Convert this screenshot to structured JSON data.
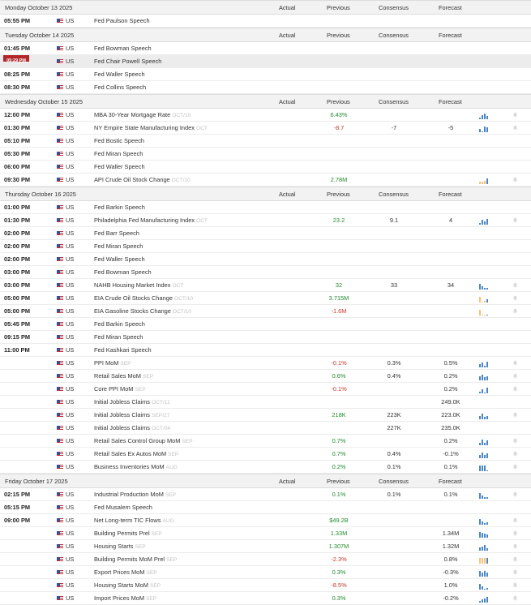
{
  "columns": {
    "actual": "Actual",
    "previous": "Previous",
    "consensus": "Consensus",
    "forecast": "Forecast"
  },
  "colors": {
    "positive": "#1f8b2c",
    "negative": "#c0392b",
    "bar": "#4a86c5",
    "bar_light": "#f5c27a",
    "live_badge": "#b2272a"
  },
  "days": [
    {
      "date": "Monday October 13 2025",
      "events": [
        {
          "time": "05:55 PM",
          "country": "US",
          "name": "Fed Paulson Speech",
          "period": "",
          "actual": "",
          "previous": "",
          "previous_tone": "",
          "consensus": "",
          "forecast": "",
          "chart": false,
          "bell": false
        }
      ]
    },
    {
      "date": "Tuesday October 14 2025",
      "events": [
        {
          "time": "01:45 PM",
          "country": "US",
          "name": "Fed Bowman Speech",
          "period": "",
          "actual": "",
          "previous": "",
          "previous_tone": "",
          "consensus": "",
          "forecast": "",
          "chart": false,
          "bell": false
        },
        {
          "time": "05:29 PM",
          "live": true,
          "country": "US",
          "name": "Fed Chair Powell Speech",
          "period": "",
          "actual": "",
          "previous": "",
          "previous_tone": "",
          "consensus": "",
          "forecast": "",
          "chart": false,
          "bell": false
        },
        {
          "time": "08:25 PM",
          "country": "US",
          "name": "Fed Waller Speech",
          "period": "",
          "actual": "",
          "previous": "",
          "previous_tone": "",
          "consensus": "",
          "forecast": "",
          "chart": false,
          "bell": false
        },
        {
          "time": "08:30 PM",
          "country": "US",
          "name": "Fed Collins Speech",
          "period": "",
          "actual": "",
          "previous": "",
          "previous_tone": "",
          "consensus": "",
          "forecast": "",
          "chart": false,
          "bell": false
        }
      ]
    },
    {
      "date": "Wednesday October 15 2025",
      "events": [
        {
          "time": "12:00 PM",
          "country": "US",
          "name": "MBA 30-Year Mortgage Rate",
          "period": "OCT/10",
          "actual": "",
          "previous": "6.43%",
          "previous_tone": "pos",
          "consensus": "",
          "forecast": "",
          "chart": true,
          "chart_bars": [
            2,
            4,
            6,
            3
          ],
          "bell": true
        },
        {
          "time": "01:30 PM",
          "country": "US",
          "name": "NY Empire State Manufacturing Index",
          "period": "OCT",
          "actual": "",
          "previous": "-8.7",
          "previous_tone": "neg",
          "consensus": "-7",
          "forecast": "-5",
          "chart": true,
          "chart_bars": [
            3,
            1,
            5,
            4
          ],
          "bell": true
        },
        {
          "time": "05:10 PM",
          "country": "US",
          "name": "Fed Bostic Speech",
          "period": "",
          "actual": "",
          "previous": "",
          "previous_tone": "",
          "consensus": "",
          "forecast": "",
          "chart": false,
          "bell": false
        },
        {
          "time": "05:30 PM",
          "country": "US",
          "name": "Fed Miran Speech",
          "period": "",
          "actual": "",
          "previous": "",
          "previous_tone": "",
          "consensus": "",
          "forecast": "",
          "chart": false,
          "bell": false
        },
        {
          "time": "06:00 PM",
          "country": "US",
          "name": "Fed Waller Speech",
          "period": "",
          "actual": "",
          "previous": "",
          "previous_tone": "",
          "consensus": "",
          "forecast": "",
          "chart": false,
          "bell": false
        },
        {
          "time": "09:30 PM",
          "country": "US",
          "name": "API Crude Oil Stock Change",
          "period": "OCT/10",
          "actual": "",
          "previous": "2.78M",
          "previous_tone": "pos",
          "consensus": "",
          "forecast": "",
          "chart": true,
          "chart_bars": [
            2,
            2,
            3,
            5
          ],
          "chart_light": true,
          "bell": true
        }
      ]
    },
    {
      "date": "Thursday October 16 2025",
      "events": [
        {
          "time": "01:00 PM",
          "country": "US",
          "name": "Fed Barkin Speech",
          "period": "",
          "actual": "",
          "previous": "",
          "previous_tone": "",
          "consensus": "",
          "forecast": "",
          "chart": false,
          "bell": false
        },
        {
          "time": "01:30 PM",
          "country": "US",
          "name": "Philadelphia Fed Manufacturing Index",
          "period": "OCT",
          "actual": "",
          "previous": "23.2",
          "previous_tone": "pos",
          "consensus": "9.1",
          "forecast": "4",
          "chart": true,
          "chart_bars": [
            2,
            5,
            3,
            6
          ],
          "bell": true
        },
        {
          "time": "02:00 PM",
          "country": "US",
          "name": "Fed Barr Speech",
          "period": "",
          "actual": "",
          "previous": "",
          "previous_tone": "",
          "consensus": "",
          "forecast": "",
          "chart": false,
          "bell": false
        },
        {
          "time": "02:00 PM",
          "country": "US",
          "name": "Fed Miran Speech",
          "period": "",
          "actual": "",
          "previous": "",
          "previous_tone": "",
          "consensus": "",
          "forecast": "",
          "chart": false,
          "bell": false
        },
        {
          "time": "02:00 PM",
          "country": "US",
          "name": "Fed Waller Speech",
          "period": "",
          "actual": "",
          "previous": "",
          "previous_tone": "",
          "consensus": "",
          "forecast": "",
          "chart": false,
          "bell": false
        },
        {
          "time": "03:00 PM",
          "country": "US",
          "name": "Fed Bowman Speech",
          "period": "",
          "actual": "",
          "previous": "",
          "previous_tone": "",
          "consensus": "",
          "forecast": "",
          "chart": false,
          "bell": false
        },
        {
          "time": "03:00 PM",
          "country": "US",
          "name": "NAHB Housing Market Index",
          "period": "OCT",
          "actual": "",
          "previous": "32",
          "previous_tone": "pos",
          "consensus": "33",
          "forecast": "34",
          "chart": true,
          "chart_bars": [
            6,
            3,
            2,
            2
          ],
          "bell": true
        },
        {
          "time": "05:00 PM",
          "country": "US",
          "name": "EIA Crude Oil Stocks Change",
          "period": "OCT/10",
          "actual": "",
          "previous": "3.715M",
          "previous_tone": "pos",
          "consensus": "",
          "forecast": "",
          "chart": true,
          "chart_bars": [
            6,
            1,
            2,
            3
          ],
          "chart_light": true,
          "bell": true
        },
        {
          "time": "05:00 PM",
          "country": "US",
          "name": "EIA Gasoline Stocks Change",
          "period": "OCT/10",
          "actual": "",
          "previous": "-1.6M",
          "previous_tone": "neg",
          "consensus": "",
          "forecast": "",
          "chart": true,
          "chart_bars": [
            7,
            1,
            1,
            1
          ],
          "chart_light": true,
          "bell": true
        },
        {
          "time": "05:45 PM",
          "country": "US",
          "name": "Fed Barkin Speech",
          "period": "",
          "actual": "",
          "previous": "",
          "previous_tone": "",
          "consensus": "",
          "forecast": "",
          "chart": false,
          "bell": false
        },
        {
          "time": "09:15 PM",
          "country": "US",
          "name": "Fed Miran Speech",
          "period": "",
          "actual": "",
          "previous": "",
          "previous_tone": "",
          "consensus": "",
          "forecast": "",
          "chart": false,
          "bell": false
        },
        {
          "time": "11:00 PM",
          "country": "US",
          "name": "Fed Kashkari Speech",
          "period": "",
          "actual": "",
          "previous": "",
          "previous_tone": "",
          "consensus": "",
          "forecast": "",
          "chart": false,
          "bell": false
        },
        {
          "time": "",
          "country": "US",
          "name": "PPI MoM",
          "period": "SEP",
          "actual": "",
          "previous": "-0.1%",
          "previous_tone": "neg",
          "consensus": "0.3%",
          "forecast": "0.5%",
          "chart": true,
          "chart_bars": [
            3,
            5,
            2,
            6
          ],
          "bell": true
        },
        {
          "time": "",
          "country": "US",
          "name": "Retail Sales MoM",
          "period": "SEP",
          "actual": "",
          "previous": "0.6%",
          "previous_tone": "pos",
          "consensus": "0.4%",
          "forecast": "0.2%",
          "chart": true,
          "chart_bars": [
            3,
            4,
            2,
            3
          ],
          "bell": true
        },
        {
          "time": "",
          "country": "US",
          "name": "Core PPI MoM",
          "period": "SEP",
          "actual": "",
          "previous": "-0.1%",
          "previous_tone": "neg",
          "consensus": "",
          "forecast": "0.2%",
          "chart": true,
          "chart_bars": [
            2,
            4,
            1,
            6
          ],
          "bell": true
        },
        {
          "time": "",
          "country": "US",
          "name": "Initial Jobless Claims",
          "period": "OCT/11",
          "actual": "",
          "previous": "",
          "previous_tone": "",
          "consensus": "",
          "forecast": "249.0K",
          "chart": false,
          "bell": false
        },
        {
          "time": "",
          "country": "US",
          "name": "Initial Jobless Claims",
          "period": "SEP/27",
          "actual": "",
          "previous": "218K",
          "previous_tone": "pos",
          "consensus": "223K",
          "forecast": "223.0K",
          "chart": true,
          "chart_bars": [
            4,
            7,
            3,
            4
          ],
          "bell": true
        },
        {
          "time": "",
          "country": "US",
          "name": "Initial Jobless Claims",
          "period": "OCT/04",
          "actual": "",
          "previous": "",
          "previous_tone": "",
          "consensus": "227K",
          "forecast": "235.0K",
          "chart": false,
          "bell": false
        },
        {
          "time": "",
          "country": "US",
          "name": "Retail Sales Control Group MoM",
          "period": "SEP",
          "actual": "",
          "previous": "0.7%",
          "previous_tone": "pos",
          "consensus": "",
          "forecast": "0.2%",
          "chart": true,
          "chart_bars": [
            2,
            5,
            2,
            4
          ],
          "bell": true
        },
        {
          "time": "",
          "country": "US",
          "name": "Retail Sales Ex Autos MoM",
          "period": "SEP",
          "actual": "",
          "previous": "0.7%",
          "previous_tone": "pos",
          "consensus": "0.4%",
          "forecast": "-0.1%",
          "chart": true,
          "chart_bars": [
            3,
            6,
            3,
            5
          ],
          "bell": true
        },
        {
          "time": "",
          "country": "US",
          "name": "Business Inventories MoM",
          "period": "AUG",
          "actual": "",
          "previous": "0.2%",
          "previous_tone": "pos",
          "consensus": "0.1%",
          "forecast": "0.1%",
          "chart": true,
          "chart_bars": [
            6,
            6,
            6,
            1
          ],
          "bell": true
        }
      ]
    },
    {
      "date": "Friday October 17 2025",
      "events": [
        {
          "time": "02:15 PM",
          "country": "US",
          "name": "Industrial Production MoM",
          "period": "SEP",
          "actual": "",
          "previous": "0.1%",
          "previous_tone": "pos",
          "consensus": "0.1%",
          "forecast": "0.1%",
          "chart": true,
          "chart_bars": [
            4,
            2,
            1,
            1
          ],
          "bell": true
        },
        {
          "time": "05:15 PM",
          "country": "US",
          "name": "Fed Musalem Speech",
          "period": "",
          "actual": "",
          "previous": "",
          "previous_tone": "",
          "consensus": "",
          "forecast": "",
          "chart": false,
          "bell": false
        },
        {
          "time": "09:00 PM",
          "country": "US",
          "name": "Net Long-term TIC Flows",
          "period": "AUG",
          "actual": "",
          "previous": "$49.2B",
          "previous_tone": "pos",
          "consensus": "",
          "forecast": "",
          "chart": true,
          "chart_bars": [
            7,
            4,
            2,
            3
          ],
          "bell": true
        },
        {
          "time": "",
          "country": "US",
          "name": "Building Permits Prel",
          "period": "SEP",
          "actual": "",
          "previous": "1.33M",
          "previous_tone": "pos",
          "consensus": "",
          "forecast": "1.34M",
          "chart": true,
          "chart_bars": [
            8,
            7,
            6,
            4
          ],
          "bell": true
        },
        {
          "time": "",
          "country": "US",
          "name": "Housing Starts",
          "period": "SEP",
          "actual": "",
          "previous": "1.307M",
          "previous_tone": "pos",
          "consensus": "",
          "forecast": "1.32M",
          "chart": true,
          "chart_bars": [
            4,
            6,
            8,
            3
          ],
          "bell": true
        },
        {
          "time": "",
          "country": "US",
          "name": "Building Permits MoM Prel",
          "period": "SEP",
          "actual": "",
          "previous": "-2.3%",
          "previous_tone": "neg",
          "consensus": "",
          "forecast": "0.8%",
          "chart": true,
          "chart_bars": [
            7,
            7,
            7,
            7
          ],
          "chart_light": true,
          "bell": true
        },
        {
          "time": "",
          "country": "US",
          "name": "Export Prices MoM",
          "period": "SEP",
          "actual": "",
          "previous": "0.3%",
          "previous_tone": "pos",
          "consensus": "",
          "forecast": "-0.3%",
          "chart": true,
          "chart_bars": [
            4,
            3,
            4,
            3
          ],
          "bell": true
        },
        {
          "time": "",
          "country": "US",
          "name": "Housing Starts MoM",
          "period": "SEP",
          "actual": "",
          "previous": "-8.5%",
          "previous_tone": "neg",
          "consensus": "",
          "forecast": "1.0%",
          "chart": true,
          "chart_bars": [
            6,
            3,
            1,
            2
          ],
          "bell": true
        },
        {
          "time": "",
          "country": "US",
          "name": "Import Prices MoM",
          "period": "SEP",
          "actual": "",
          "previous": "0.3%",
          "previous_tone": "pos",
          "consensus": "",
          "forecast": "-0.2%",
          "chart": true,
          "chart_bars": [
            2,
            3,
            4,
            6
          ],
          "bell": true
        }
      ]
    }
  ]
}
